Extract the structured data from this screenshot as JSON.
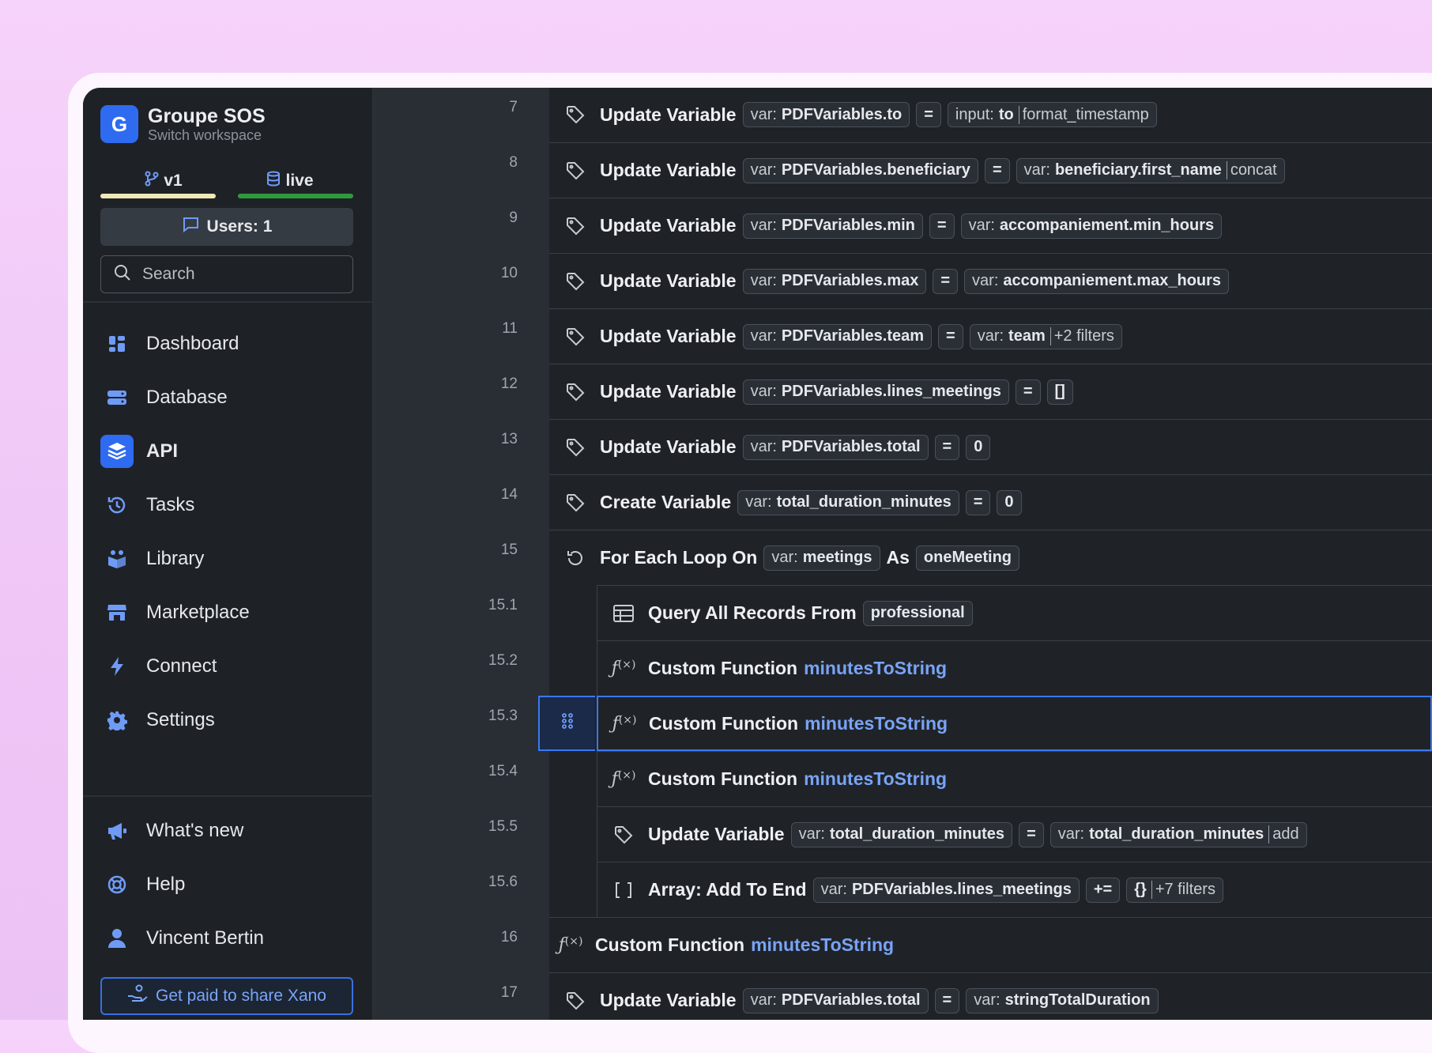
{
  "workspace": {
    "initial": "G",
    "name": "Groupe SOS",
    "subtitle": "Switch workspace"
  },
  "branches": [
    {
      "label": "v1"
    },
    {
      "label": "live"
    }
  ],
  "users_label": "Users: 1",
  "search": {
    "placeholder": "Search"
  },
  "nav": [
    {
      "label": "Dashboard"
    },
    {
      "label": "Database"
    },
    {
      "label": "API"
    },
    {
      "label": "Tasks"
    },
    {
      "label": "Library"
    },
    {
      "label": "Marketplace"
    },
    {
      "label": "Connect"
    },
    {
      "label": "Settings"
    }
  ],
  "bottom_nav": [
    {
      "label": "What's new"
    },
    {
      "label": "Help"
    },
    {
      "label": "Vincent Bertin"
    }
  ],
  "share_label": "Get paid to share Xano",
  "colors": {
    "accent": "#2f6bf0",
    "link": "#79a3f5",
    "live": "#2e9a3c",
    "v1": "#f1e8b8"
  },
  "lines": [
    "7",
    "8",
    "9",
    "10",
    "11",
    "12",
    "13",
    "14",
    "15",
    "15.1",
    "15.2",
    "15.3",
    "15.4",
    "15.5",
    "15.6",
    "16",
    "17"
  ],
  "steps": [
    {
      "title": "Update Variable",
      "var": "PDFVariables.to",
      "op": "=",
      "val_pre": "input:",
      "val_bold": "to",
      "val_post": "format_timestamp"
    },
    {
      "title": "Update Variable",
      "var": "PDFVariables.beneficiary",
      "op": "=",
      "val_pre": "var:",
      "val_bold": "beneficiary.first_name",
      "val_post": "concat"
    },
    {
      "title": "Update Variable",
      "var": "PDFVariables.min",
      "op": "=",
      "val_pre": "var:",
      "val_bold": "accompaniement.min_hours",
      "val_post": ""
    },
    {
      "title": "Update Variable",
      "var": "PDFVariables.max",
      "op": "=",
      "val_pre": "var:",
      "val_bold": "accompaniement.max_hours",
      "val_post": ""
    },
    {
      "title": "Update Variable",
      "var": "PDFVariables.team",
      "op": "=",
      "val_pre": "var:",
      "val_bold": "team",
      "val_post": "+2 filters"
    },
    {
      "title": "Update Variable",
      "var": "PDFVariables.lines_meetings",
      "op": "=",
      "val_pre": "",
      "val_bold": "[]",
      "val_post": ""
    },
    {
      "title": "Update Variable",
      "var": "PDFVariables.total",
      "op": "=",
      "val_pre": "",
      "val_bold": "0",
      "val_post": ""
    },
    {
      "title": "Create Variable",
      "var": "total_duration_minutes",
      "op": "=",
      "val_pre": "",
      "val_bold": "0",
      "val_post": ""
    },
    {
      "title": "For Each Loop On",
      "var": "meetings",
      "as": "As",
      "alias": "oneMeeting"
    },
    {
      "title": "Query All Records From",
      "table": "professional"
    },
    {
      "title": "Custom Function",
      "fn": "minutesToString"
    },
    {
      "title": "Custom Function",
      "fn": "minutesToString"
    },
    {
      "title": "Custom Function",
      "fn": "minutesToString"
    },
    {
      "title": "Update Variable",
      "var": "total_duration_minutes",
      "op": "=",
      "val_pre": "var:",
      "val_bold": "total_duration_minutes",
      "val_post": "add"
    },
    {
      "title": "Array: Add To End",
      "var": "PDFVariables.lines_meetings",
      "op": "+=",
      "val_pre": "",
      "val_bold": "{}",
      "val_post": "+7 filters"
    },
    {
      "title": "Custom Function",
      "fn": "minutesToString"
    },
    {
      "title": "Update Variable",
      "var": "PDFVariables.total",
      "op": "=",
      "val_pre": "var:",
      "val_bold": "stringTotalDuration",
      "val_post": ""
    }
  ],
  "var_prefix": "var:"
}
